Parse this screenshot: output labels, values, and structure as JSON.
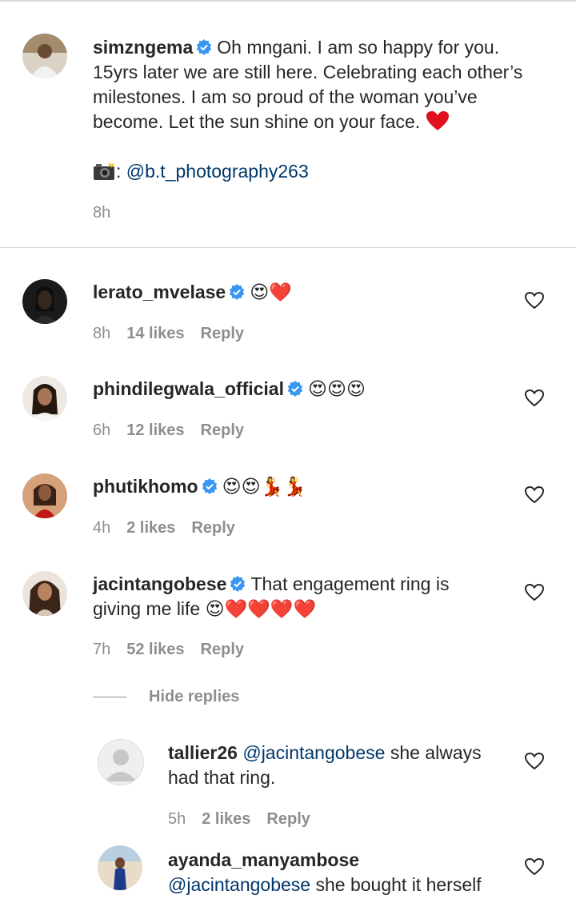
{
  "caption": {
    "username": "simzngema",
    "text": "Oh mngani. I am so happy for you. 15yrs later we are still here. Celebrating each other’s milestones. I am so proud of the woman you’ve become. Let the sun shine on your face.",
    "credit_prefix": ":",
    "credit_mention": "@b.t_photography263",
    "time": "8h"
  },
  "comments": [
    {
      "username": "lerato_mvelase",
      "emoji": "😍❤️",
      "time": "8h",
      "likes": "14 likes",
      "reply": "Reply"
    },
    {
      "username": "phindilegwala_official",
      "emoji": "😍😍😍",
      "time": "6h",
      "likes": "12 likes",
      "reply": "Reply"
    },
    {
      "username": "phutikhomo",
      "emoji": "😍😍💃💃",
      "time": "4h",
      "likes": "2 likes",
      "reply": "Reply"
    },
    {
      "username": "jacintangobese",
      "text_line1": "That engagement ring is",
      "text_line2": "giving me life",
      "emoji": "😍❤️❤️❤️❤️",
      "time": "7h",
      "likes": "52 likes",
      "reply": "Reply"
    }
  ],
  "hide_replies": "Hide replies",
  "replies": [
    {
      "username": "tallier26",
      "mention": "@jacintangobese",
      "text_line1": "she always",
      "text_line2": "had that ring.",
      "time": "5h",
      "likes": "2 likes",
      "reply": "Reply"
    },
    {
      "username": "ayanda_manyambose",
      "mention": "@jacintangobese",
      "text": "she bought it herself"
    }
  ],
  "colors": {
    "verified": "#3897f0",
    "mention": "#00376b",
    "meta": "#8e8e8e"
  }
}
